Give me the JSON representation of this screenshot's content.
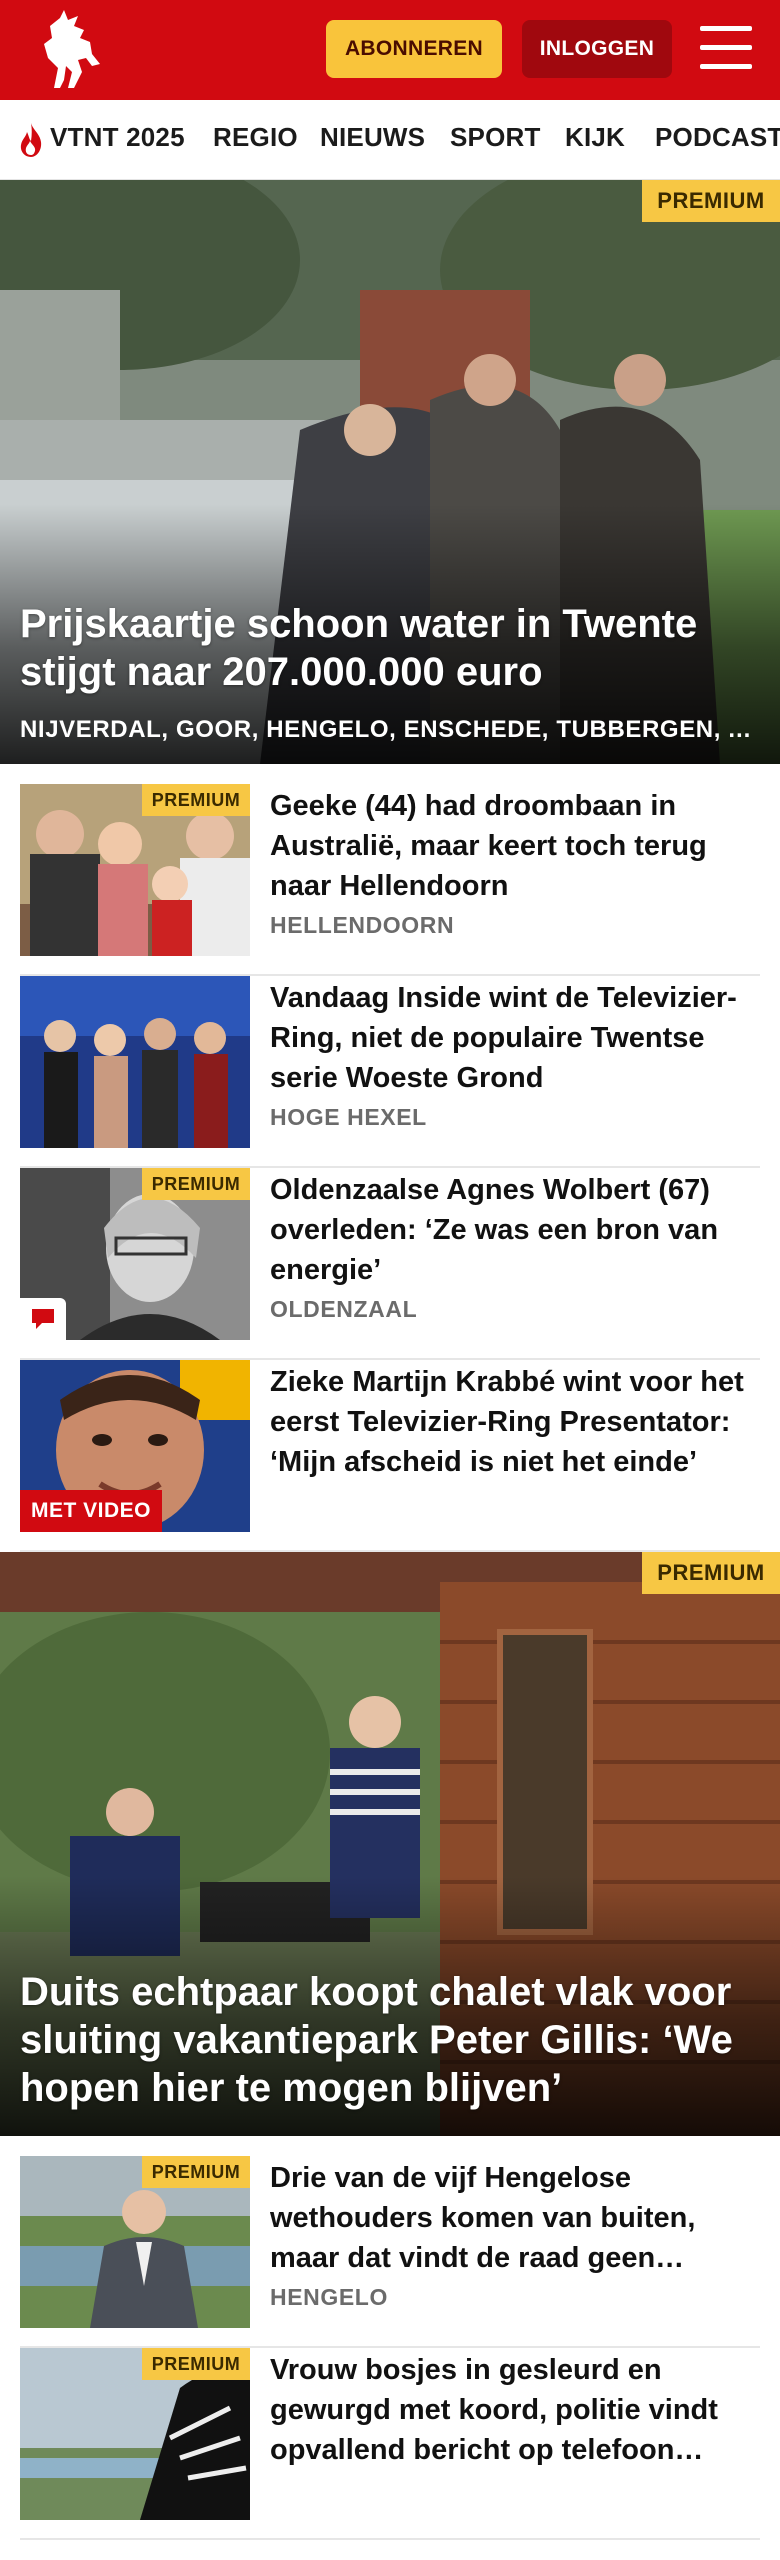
{
  "header": {
    "subscribe_label": "ABONNEREN",
    "login_label": "INLOGGEN",
    "brand_color": "#d10a11",
    "logo_icon": "tubantia-horse-logo",
    "menu_icon": "hamburger-menu-icon"
  },
  "nav": {
    "items": [
      {
        "label": "VTNT 2025",
        "icon": "flame-icon"
      },
      {
        "label": "REGIO"
      },
      {
        "label": "NIEUWS"
      },
      {
        "label": "SPORT"
      },
      {
        "label": "KIJK"
      },
      {
        "label": "PODCAST"
      }
    ]
  },
  "hero1": {
    "premium": "PREMIUM",
    "title": "Prijskaartje schoon water in Twente stijgt naar 207.000.000 euro",
    "places": "NIJVERDAL, GOOR, HENGELO, ENSCHEDE, TUBBERGEN, ALMELO"
  },
  "articles": [
    {
      "title": "Geeke (44) had droombaan in Australië, maar keert toch terug naar Hellendoorn",
      "location": "HELLENDOORN",
      "premium": "PREMIUM"
    },
    {
      "title": "Vandaag Inside wint de Televizier-Ring, niet de populaire Twentse serie Woeste Grond",
      "location": "HOGE HEXEL"
    },
    {
      "title": "Oldenzaalse Agnes Wolbert (67) overleden: ‘Ze was een bron van energie’",
      "location": "OLDENZAAL",
      "premium": "PREMIUM",
      "comment_icon": "comment-icon"
    },
    {
      "title": "Zieke Martijn Krabbé wint voor het eerst Televizier-Ring Presentator: ‘Mijn afscheid is niet het einde’",
      "video": "MET VIDEO"
    }
  ],
  "hero2": {
    "premium": "PREMIUM",
    "title": "Duits echtpaar koopt chalet vlak voor sluiting vakantiepark Peter Gillis: ‘We hopen hier te mogen blijven’"
  },
  "articles2": [
    {
      "title": "Drie van de vijf Hengelose wethouders komen van buiten, maar dat vindt de raad geen probleem",
      "location": "HENGELO",
      "premium": "PREMIUM"
    },
    {
      "title": "Vrouw bosjes in gesleurd en gewurgd met koord, politie vindt opvallend bericht op telefoon verdachte",
      "premium": "PREMIUM"
    }
  ]
}
